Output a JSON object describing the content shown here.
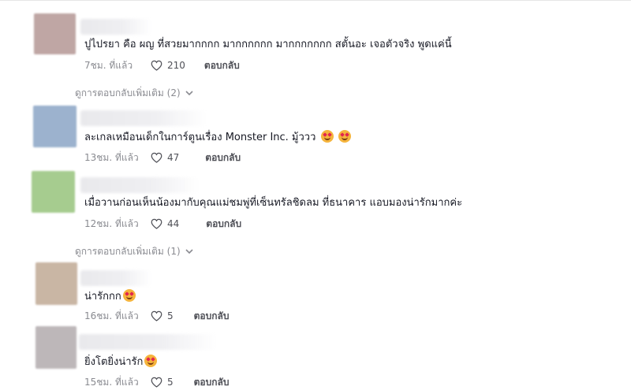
{
  "comments": [
    {
      "text": "ปูไปรยา คือ ผญ ที่สวยมากกกก มากกกกกก มากกกกกกก สตั้นอะ เจอตัวจริง พูดแค่นี้",
      "time": "7ชม. ที่แล้ว",
      "likes": "210",
      "reply": "ตอบกลับ",
      "avatar_color": "#bfa6a4",
      "emojis": 0
    },
    {
      "text": "ละเกลเหมือนเด็กในการ์ตูนเรื่อง Monster Inc. มู้ววว",
      "time": "13ชม. ที่แล้ว",
      "likes": "47",
      "reply": "ตอบกลับ",
      "avatar_color": "#9cb2ce",
      "emojis": 2
    },
    {
      "text": "เมื่อวานก่อนเห็นน้องมากับคุณแม่ชมพู่ที่เซ็นทรัลชิดลม ที่ธนาคาร แอบมองน่ารักมากค่ะ",
      "time": "12ชม. ที่แล้ว",
      "likes": "44",
      "reply": "ตอบกลับ",
      "avatar_color": "#a6cc8f",
      "emojis": 0
    },
    {
      "text": "น่ารักกก",
      "time": "16ชม. ที่แล้ว",
      "likes": "5",
      "reply": "ตอบกลับ",
      "avatar_color": "#c9b6a4",
      "emojis": 1
    },
    {
      "text": "ยิ่งโตยิ่งน่ารัก",
      "time": "15ชม. ที่แล้ว",
      "likes": "5",
      "reply": "ตอบกลับ",
      "avatar_color": "#bdb7b9",
      "emojis": 1
    }
  ],
  "more_replies": [
    {
      "label": "ดูการตอบกลับเพิ่มเติม (2)"
    },
    {
      "label": "ดูการตอบกลับเพิ่มเติม (1)"
    }
  ],
  "icons": {
    "like": "heart-outline-icon",
    "expand": "chevron-down-icon",
    "emoji": "smiling-face-with-hearts-emoji"
  }
}
